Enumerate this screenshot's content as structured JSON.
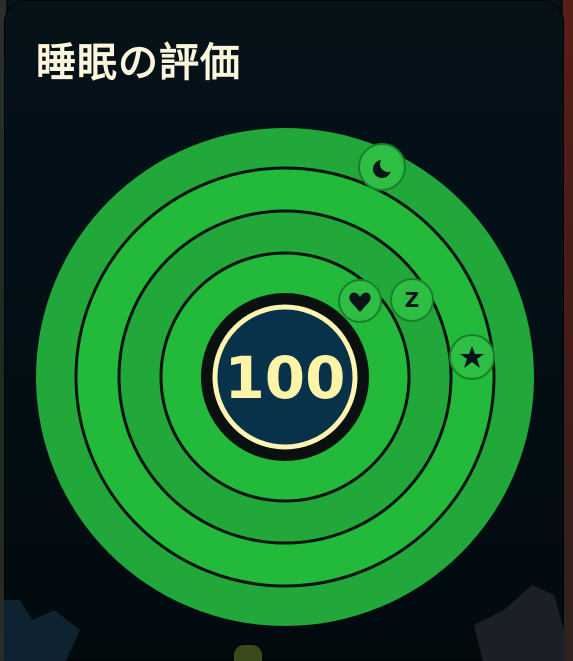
{
  "card": {
    "title": "睡眠の評価"
  },
  "score": {
    "value": "100"
  },
  "rings": {
    "count": 4,
    "colors": {
      "outer": "#22a83a",
      "band": "#23b93b",
      "border": "#08140c",
      "core": "#07324a",
      "core_border": "#fff4b0"
    }
  },
  "badges": [
    {
      "icon": "moon-icon",
      "label": ""
    },
    {
      "icon": "star-icon",
      "label": ""
    },
    {
      "icon": "z-icon",
      "label": "Z"
    },
    {
      "icon": "heart-icon",
      "label": ""
    }
  ]
}
